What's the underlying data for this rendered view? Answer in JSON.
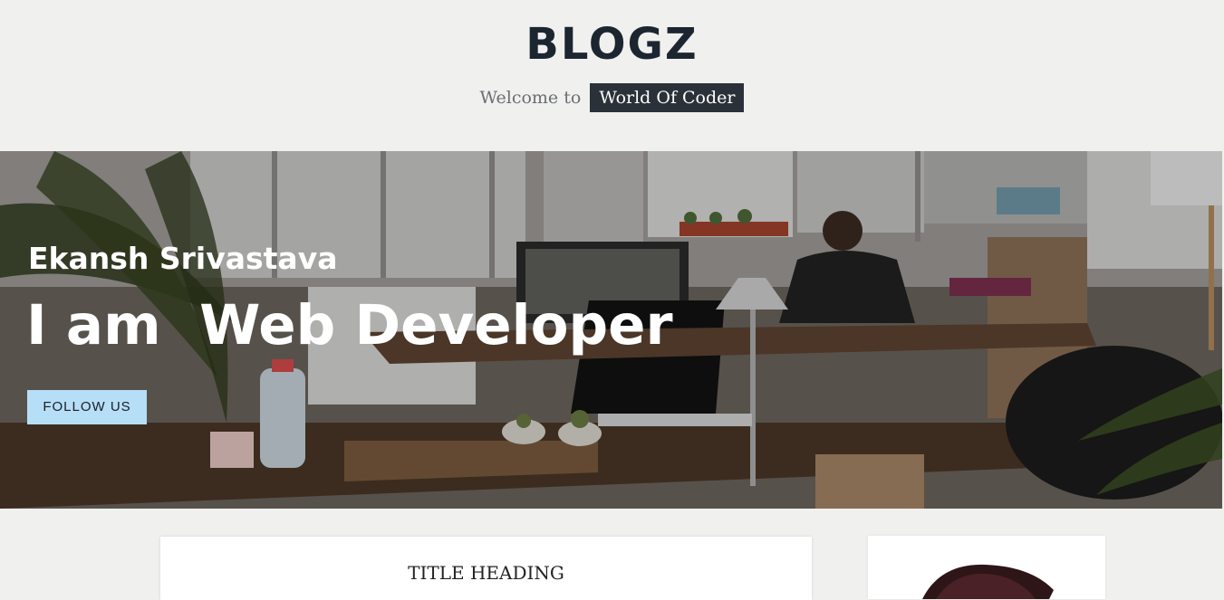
{
  "header": {
    "brand": "BLOGZ",
    "welcome_text": "Welcome to",
    "welcome_highlight": "World Of Coder"
  },
  "hero": {
    "name": "Ekansh Srivastava",
    "role_line": "I am  Web Developer",
    "follow_button": "FOLLOW US",
    "follow_button_color": "#b6def7"
  },
  "main_card": {
    "title": "TITLE HEADING"
  },
  "side_card": {
    "avatar_icon": "profile-avatar-illustration"
  },
  "colors": {
    "background": "#f0f0ee",
    "brand": "#1c2630",
    "highlight_bg": "#2b3138"
  }
}
